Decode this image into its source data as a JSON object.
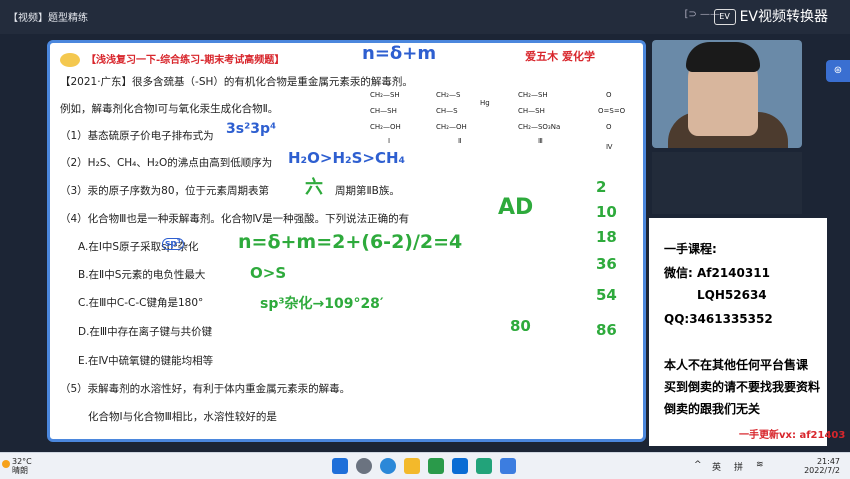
{
  "window": {
    "title": "【视频】题型精练",
    "brand": "EV视频转换器",
    "logo": "EV",
    "mini": "[⊃ ——"
  },
  "slide": {
    "header": "浅浅复习一下-综合练习-期末考试高频题",
    "brand_right": "爱五木 爱化学",
    "lines": [
      "【2021·广东】很多含巯基（-SH）的有机化合物是重金属元素汞的解毒剂。",
      "例如，解毒剂化合物Ⅰ可与氧化汞生成化合物Ⅱ。",
      "（1）基态硫原子价电子排布式为",
      "（2）H₂S、CH₄、H₂O的沸点由高到低顺序为",
      "（3）汞的原子序数为80，位于元素周期表第",
      "周期第ⅡB族。",
      "（4）化合物Ⅲ也是一种汞解毒剂。化合物Ⅳ是一种强酸。下列说法正确的有",
      "A.在Ⅰ中S原子采取sp³杂化",
      "B.在Ⅱ中S元素的电负性最大",
      "C.在Ⅲ中C-C-C键角是180°",
      "D.在Ⅲ中存在离子键与共价键",
      "E.在Ⅳ中硫氧键的键能均相等",
      "（5）汞解毒剂的水溶性好，有利于体内重金属元素汞的解毒。",
      "化合物Ⅰ与化合物Ⅲ相比，水溶性较好的是"
    ],
    "chem": {
      "I": [
        "CH₂—SH",
        "CH—SH",
        "CH₂—OH",
        "Ⅰ"
      ],
      "II": [
        "CH₂—S",
        "CH—S",
        "CH₂—OH",
        "Hg",
        "Ⅱ"
      ],
      "III": [
        "CH₂—SH",
        "CH—SH",
        "CH₂—SO₃Na",
        "Ⅲ"
      ],
      "IV": [
        "O",
        "O=S=O",
        "O",
        "Ⅳ"
      ]
    },
    "handwriting": {
      "formula_top": "n=δ+m",
      "hybrid": "sp³",
      "config": "3s²3p⁴",
      "order": "H₂O>H₂S>CH₄",
      "period": "六",
      "answer": "AD",
      "calc": "n=δ+m=2+(6-2)/2=4",
      "b_note": "O>S",
      "c_note": "sp³杂化→109°28′",
      "numbers": [
        "2",
        "10",
        "18",
        "36",
        "54",
        "86"
      ],
      "circled": "80"
    }
  },
  "note": {
    "lines": [
      "一手课程:",
      "微信: Af2140311",
      "LQH52634",
      "QQ:3461335352",
      "本人不在其他任何平台售课",
      "买到倒卖的请不要找我要资料",
      "倒卖的跟我们无关"
    ],
    "footer": "一手更新vx: af21403"
  },
  "taskbar": {
    "temp": "32°C",
    "weather": "晴朗",
    "tray": {
      "chevron": "^",
      "lang": "英",
      "ime": "拼",
      "time": "21:47",
      "date": "2022/7/2"
    }
  }
}
